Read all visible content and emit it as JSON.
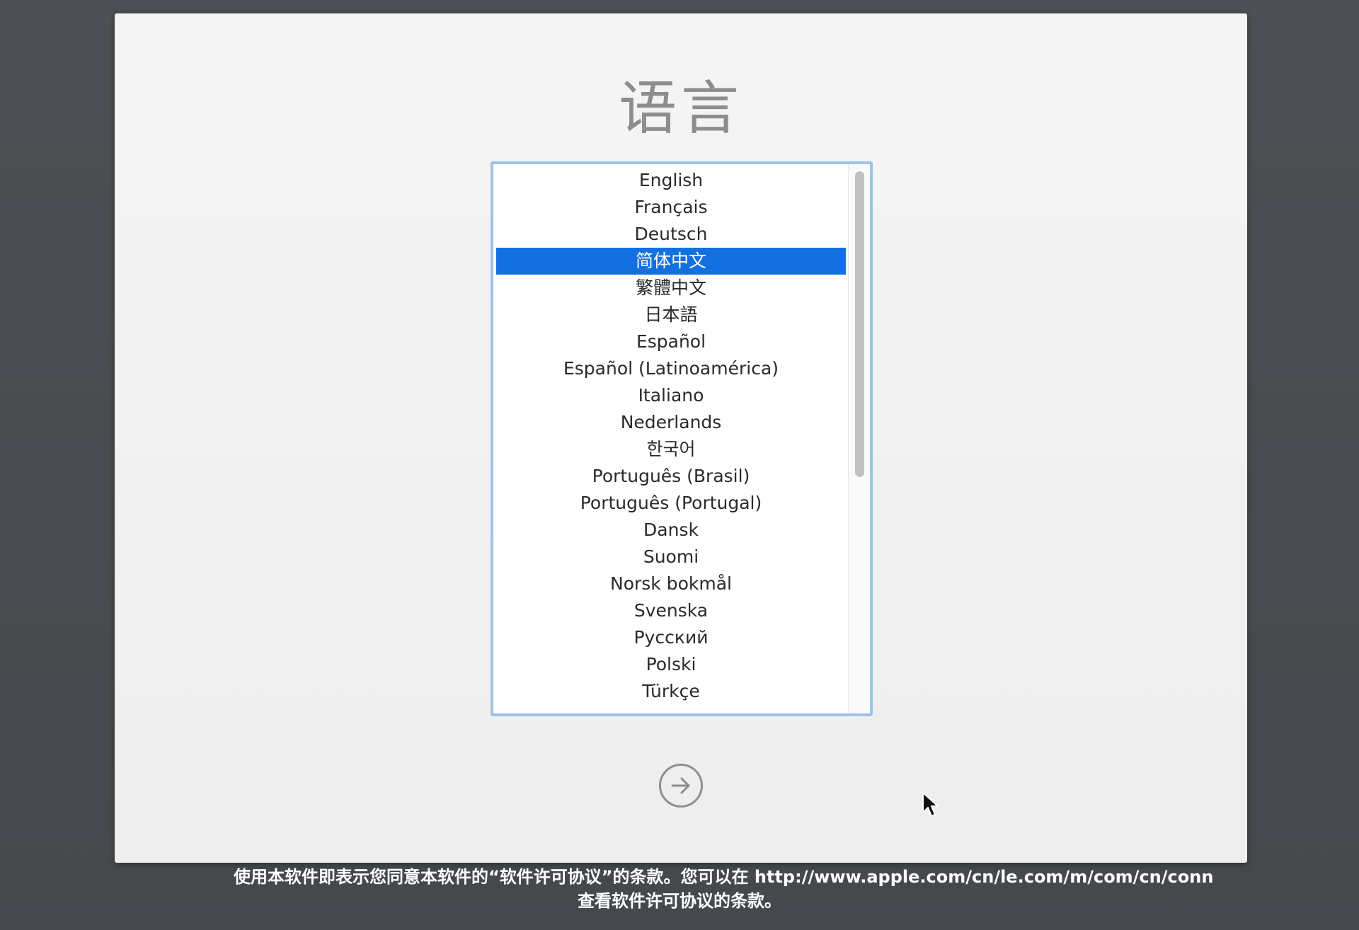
{
  "window": {
    "title": "语言"
  },
  "language_list": {
    "selected_index": 3,
    "items": [
      {
        "label": "English"
      },
      {
        "label": "Français"
      },
      {
        "label": "Deutsch"
      },
      {
        "label": "简体中文"
      },
      {
        "label": "繁體中文"
      },
      {
        "label": "日本語"
      },
      {
        "label": "Español"
      },
      {
        "label": "Español (Latinoamérica)"
      },
      {
        "label": "Italiano"
      },
      {
        "label": "Nederlands"
      },
      {
        "label": "한국어"
      },
      {
        "label": "Português (Brasil)"
      },
      {
        "label": "Português (Portugal)"
      },
      {
        "label": "Dansk"
      },
      {
        "label": "Suomi"
      },
      {
        "label": "Norsk bokmål"
      },
      {
        "label": "Svenska"
      },
      {
        "label": "Русский"
      },
      {
        "label": "Polski"
      },
      {
        "label": "Türkçe"
      }
    ]
  },
  "next_button": {
    "icon": "arrow-right-circle-icon"
  },
  "footer": {
    "line1": "使用本软件即表示您同意本软件的“软件许可协议”的条款。您可以在 http://www.apple.com/cn/le.com/m/com/cn/conn",
    "line2": "查看软件许可协议的条款。"
  },
  "colors": {
    "selection": "#1470e0",
    "list_border": "#9cc3ea",
    "background": "#494c50"
  }
}
